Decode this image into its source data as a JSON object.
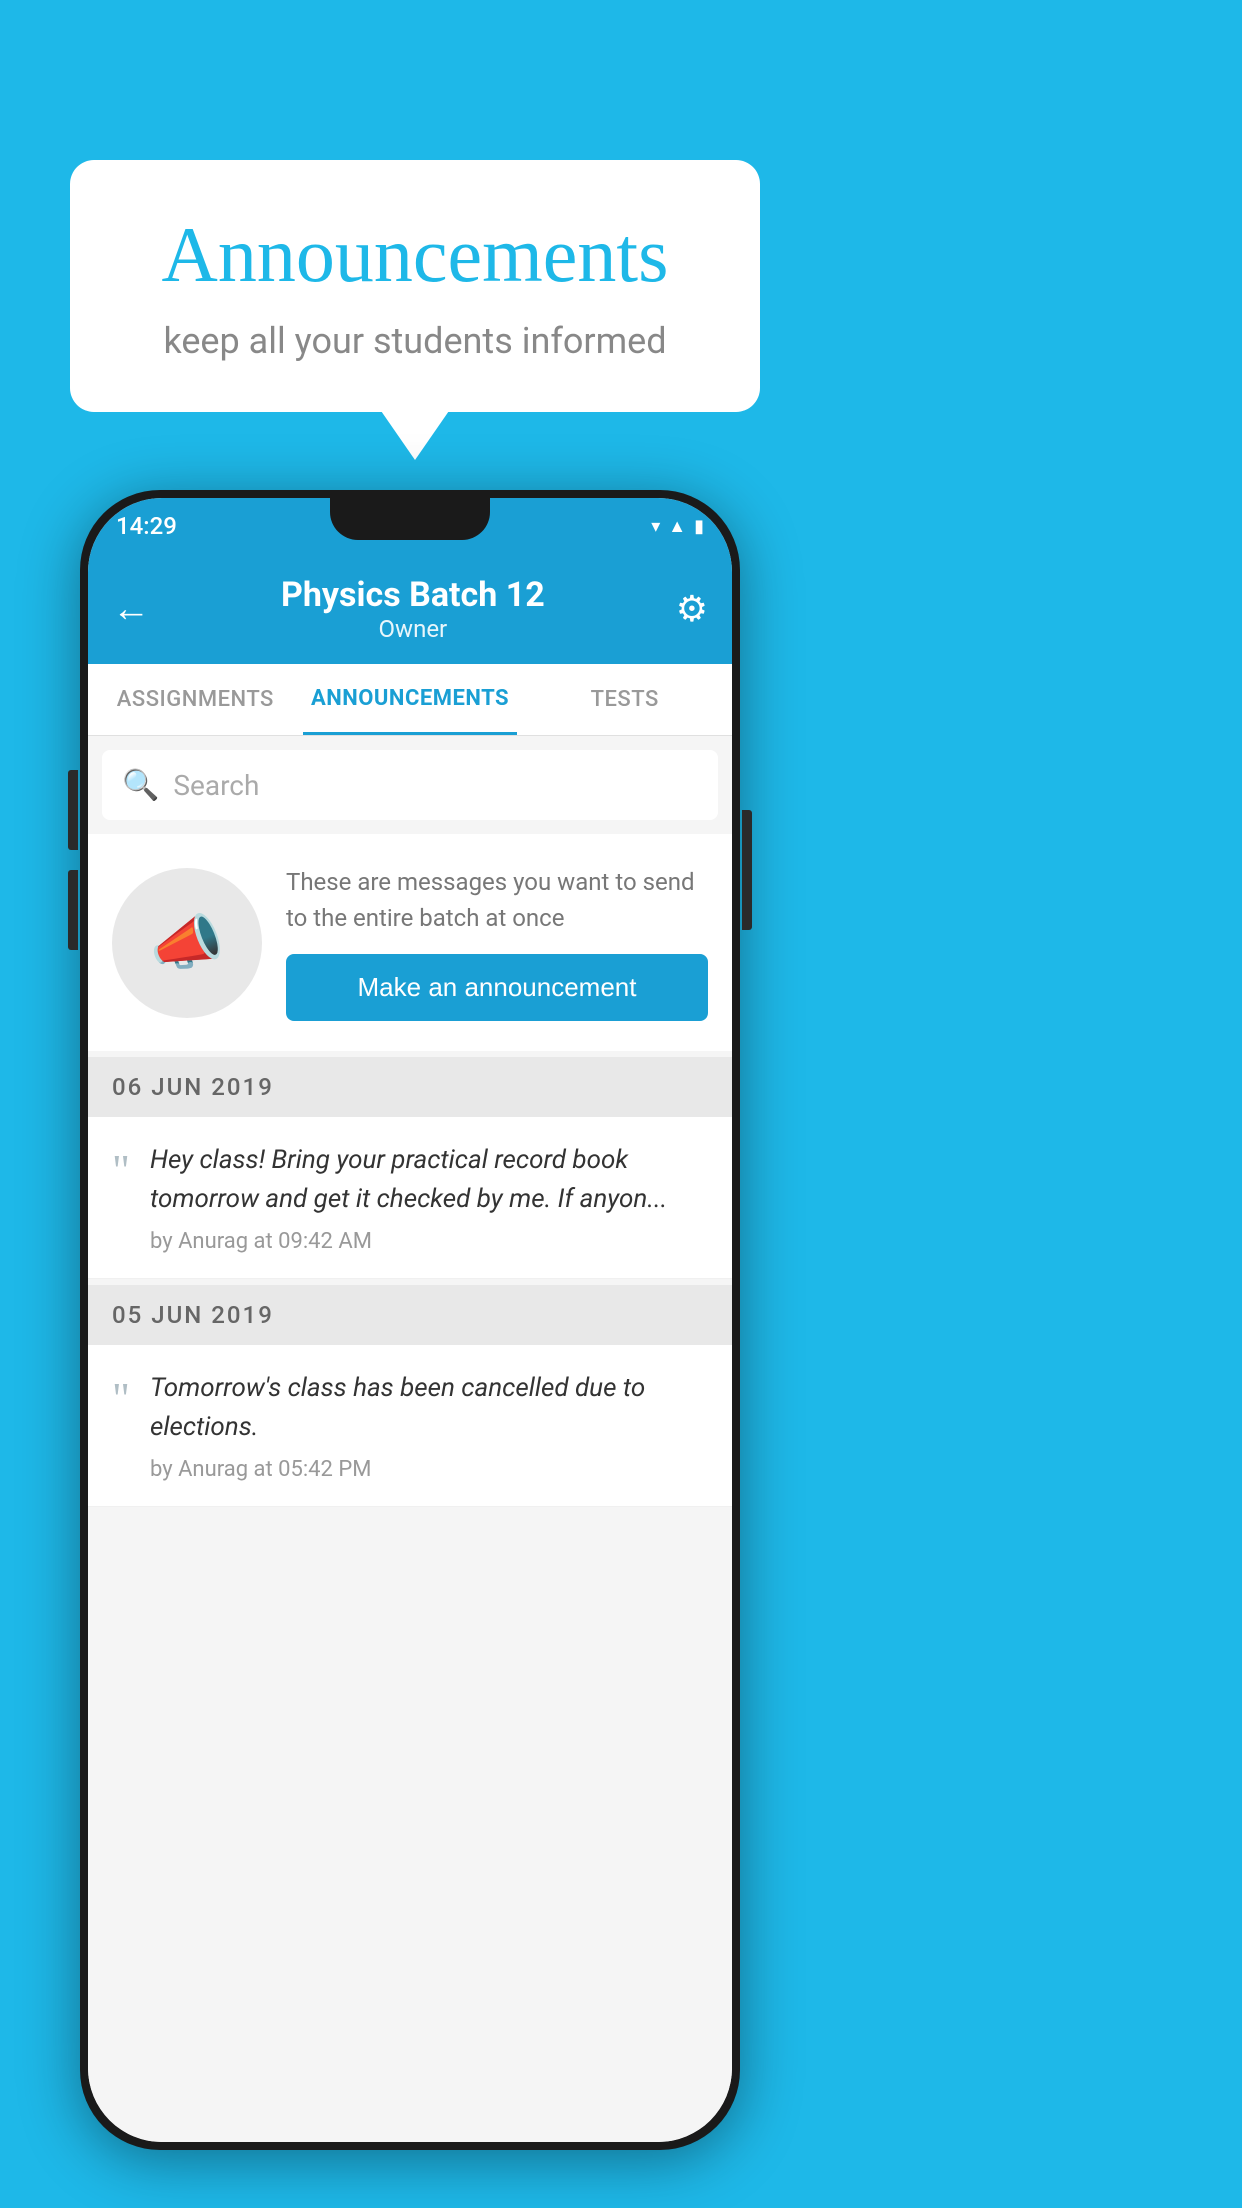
{
  "background_color": "#1eb8e8",
  "bubble": {
    "title": "Announcements",
    "subtitle": "keep all your students informed"
  },
  "status_bar": {
    "time": "14:29",
    "icons": "▼◀█"
  },
  "app_bar": {
    "back_label": "←",
    "title": "Physics Batch 12",
    "subtitle": "Owner",
    "gear_label": "⚙"
  },
  "tabs": [
    {
      "label": "ASSIGNMENTS",
      "active": false
    },
    {
      "label": "ANNOUNCEMENTS",
      "active": true
    },
    {
      "label": "TESTS",
      "active": false
    }
  ],
  "search": {
    "placeholder": "Search"
  },
  "announcement_cta": {
    "description": "These are messages you want to send to the entire batch at once",
    "button_label": "Make an announcement"
  },
  "announcements": [
    {
      "date": "06  JUN  2019",
      "text": "Hey class! Bring your practical record book tomorrow and get it checked by me. If anyon...",
      "meta": "by Anurag at 09:42 AM"
    },
    {
      "date": "05  JUN  2019",
      "text": "Tomorrow's class has been cancelled due to elections.",
      "meta": "by Anurag at 05:42 PM"
    }
  ]
}
